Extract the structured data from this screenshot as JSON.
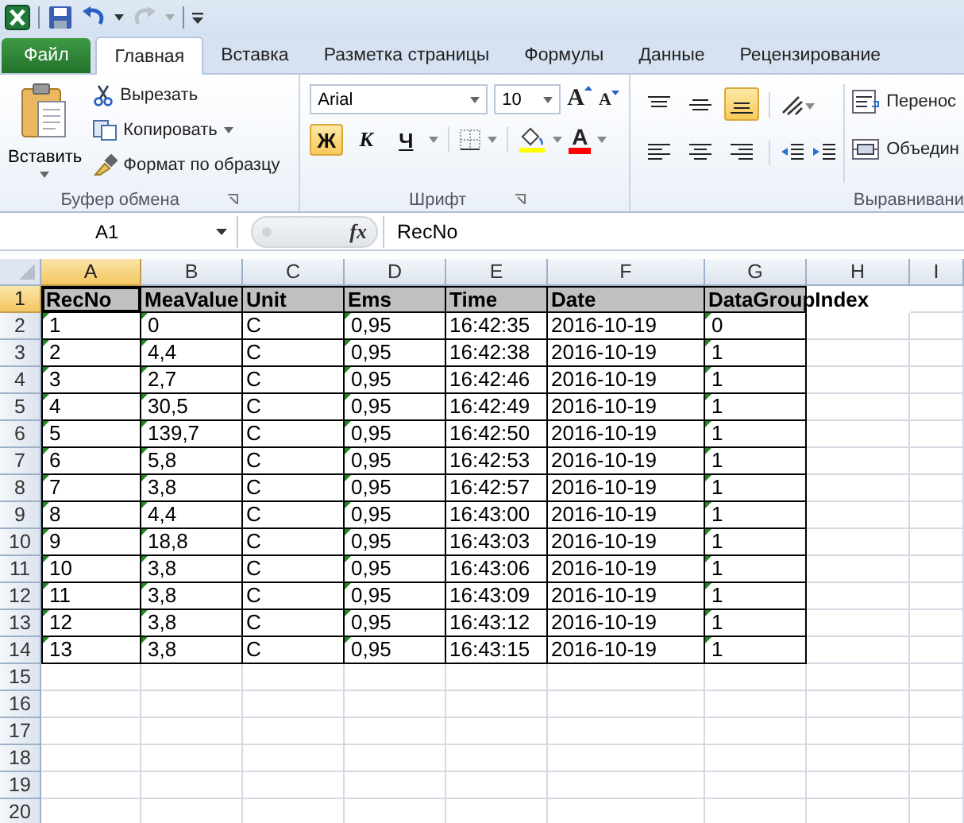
{
  "tabs": [
    {
      "label": "Файл",
      "kind": "file",
      "selected": false
    },
    {
      "label": "Главная",
      "kind": "tab",
      "selected": true
    },
    {
      "label": "Вставка",
      "kind": "tab",
      "selected": false
    },
    {
      "label": "Разметка страницы",
      "kind": "tab",
      "selected": false
    },
    {
      "label": "Формулы",
      "kind": "tab",
      "selected": false
    },
    {
      "label": "Данные",
      "kind": "tab",
      "selected": false
    },
    {
      "label": "Рецензирование",
      "kind": "tab",
      "selected": false
    }
  ],
  "clipboard": {
    "title": "Буфер обмена",
    "paste": "Вставить",
    "items": [
      {
        "label": "Вырезать",
        "kind": "cut",
        "dropdown": false
      },
      {
        "label": "Копировать",
        "kind": "copy",
        "dropdown": true
      },
      {
        "label": "Формат по образцу",
        "kind": "painter",
        "dropdown": false
      }
    ]
  },
  "font": {
    "title": "Шрифт",
    "family": "Arial",
    "size": "10",
    "grow": "A",
    "shrink": "A",
    "styles": [
      {
        "label": "Ж",
        "kind": "bold",
        "selected": true
      },
      {
        "label": "К",
        "kind": "italic",
        "selected": false
      },
      {
        "label": "Ч",
        "kind": "underline",
        "selected": false
      }
    ],
    "font_color": "A"
  },
  "alignment": {
    "title": "Выравнивани",
    "vertical": [
      {
        "kind": "top",
        "selected": false
      },
      {
        "kind": "middle",
        "selected": false
      },
      {
        "kind": "bottom",
        "selected": true
      }
    ],
    "horizontal": [
      {
        "kind": "left",
        "selected": false
      },
      {
        "kind": "center",
        "selected": false
      },
      {
        "kind": "right",
        "selected": false
      }
    ],
    "wrap": "Перенос",
    "merge": "Объедин"
  },
  "formula_bar": {
    "name_box": "A1",
    "function_label": "fx",
    "formula": "RecNo"
  },
  "sheet": {
    "columns": [
      {
        "label": "A",
        "selected": true,
        "marks": true
      },
      {
        "label": "B",
        "selected": false,
        "marks": true
      },
      {
        "label": "C",
        "selected": false,
        "marks": false
      },
      {
        "label": "D",
        "selected": false,
        "marks": true
      },
      {
        "label": "E",
        "selected": false,
        "marks": false
      },
      {
        "label": "F",
        "selected": false,
        "marks": false
      },
      {
        "label": "G",
        "selected": false,
        "marks": true
      },
      {
        "label": "H",
        "selected": false
      },
      {
        "label": "I",
        "selected": false
      }
    ],
    "rows": [
      {
        "number": "1",
        "kind": "header",
        "selected": true,
        "cells": [
          "RecNo",
          "MeaValue",
          "Unit",
          "Ems",
          "Time",
          "Date",
          "DataGroupIndex"
        ]
      },
      {
        "number": "2",
        "kind": "data",
        "selected": false,
        "cells": [
          "1",
          "0",
          "C",
          "0,95",
          "16:42:35",
          "2016-10-19",
          "0"
        ]
      },
      {
        "number": "3",
        "kind": "data",
        "selected": false,
        "cells": [
          "2",
          "4,4",
          "C",
          "0,95",
          "16:42:38",
          "2016-10-19",
          "1"
        ]
      },
      {
        "number": "4",
        "kind": "data",
        "selected": false,
        "cells": [
          "3",
          "2,7",
          "C",
          "0,95",
          "16:42:46",
          "2016-10-19",
          "1"
        ]
      },
      {
        "number": "5",
        "kind": "data",
        "selected": false,
        "cells": [
          "4",
          "30,5",
          "C",
          "0,95",
          "16:42:49",
          "2016-10-19",
          "1"
        ]
      },
      {
        "number": "6",
        "kind": "data",
        "selected": false,
        "cells": [
          "5",
          "139,7",
          "C",
          "0,95",
          "16:42:50",
          "2016-10-19",
          "1"
        ]
      },
      {
        "number": "7",
        "kind": "data",
        "selected": false,
        "cells": [
          "6",
          "5,8",
          "C",
          "0,95",
          "16:42:53",
          "2016-10-19",
          "1"
        ]
      },
      {
        "number": "8",
        "kind": "data",
        "selected": false,
        "cells": [
          "7",
          "3,8",
          "C",
          "0,95",
          "16:42:57",
          "2016-10-19",
          "1"
        ]
      },
      {
        "number": "9",
        "kind": "data",
        "selected": false,
        "cells": [
          "8",
          "4,4",
          "C",
          "0,95",
          "16:43:00",
          "2016-10-19",
          "1"
        ]
      },
      {
        "number": "10",
        "kind": "data",
        "selected": false,
        "cells": [
          "9",
          "18,8",
          "C",
          "0,95",
          "16:43:03",
          "2016-10-19",
          "1"
        ]
      },
      {
        "number": "11",
        "kind": "data",
        "selected": false,
        "cells": [
          "10",
          "3,8",
          "C",
          "0,95",
          "16:43:06",
          "2016-10-19",
          "1"
        ]
      },
      {
        "number": "12",
        "kind": "data",
        "selected": false,
        "cells": [
          "11",
          "3,8",
          "C",
          "0,95",
          "16:43:09",
          "2016-10-19",
          "1"
        ]
      },
      {
        "number": "13",
        "kind": "data",
        "selected": false,
        "cells": [
          "12",
          "3,8",
          "C",
          "0,95",
          "16:43:12",
          "2016-10-19",
          "1"
        ]
      },
      {
        "number": "14",
        "kind": "data",
        "selected": false,
        "cells": [
          "13",
          "3,8",
          "C",
          "0,95",
          "16:43:15",
          "2016-10-19",
          "1"
        ]
      },
      {
        "number": "15",
        "kind": "empty",
        "selected": false,
        "cells": []
      },
      {
        "number": "16",
        "kind": "empty",
        "selected": false,
        "cells": []
      },
      {
        "number": "17",
        "kind": "empty",
        "selected": false,
        "cells": []
      },
      {
        "number": "18",
        "kind": "empty",
        "selected": false,
        "cells": []
      },
      {
        "number": "19",
        "kind": "empty",
        "selected": false,
        "cells": []
      },
      {
        "number": "20",
        "kind": "empty",
        "selected": false,
        "cells": []
      }
    ]
  }
}
